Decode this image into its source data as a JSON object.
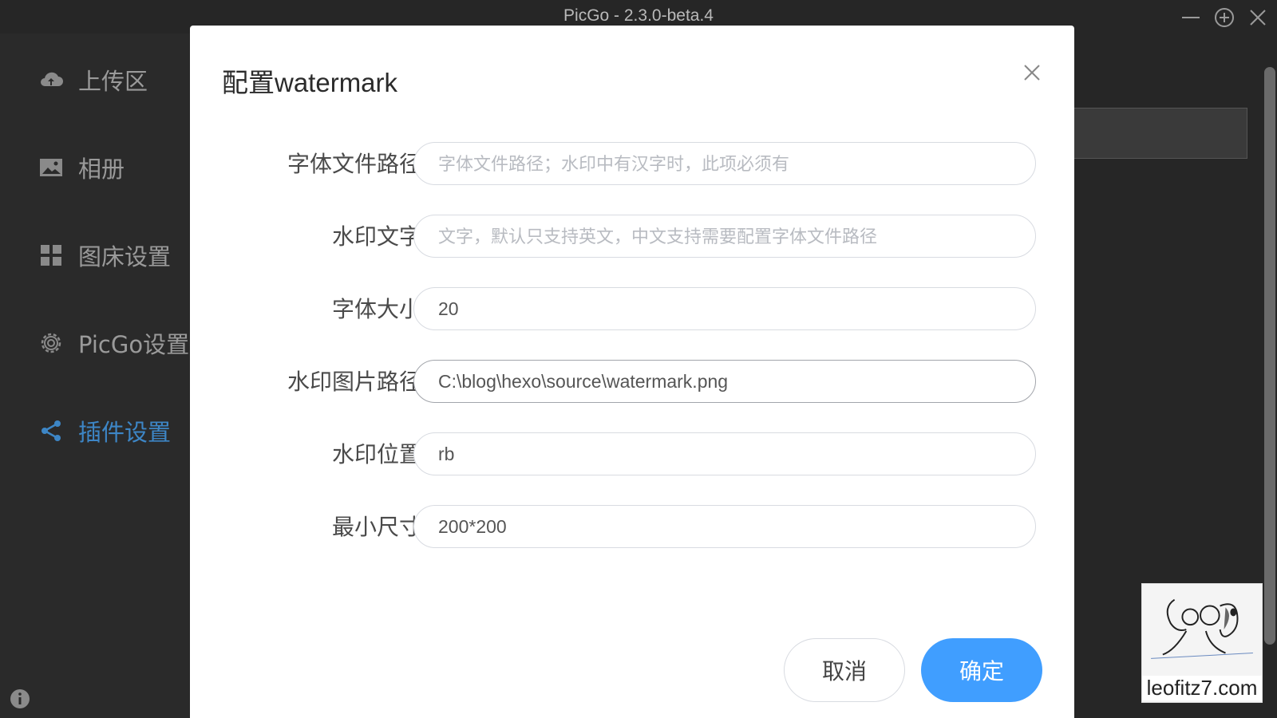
{
  "window": {
    "title": "PicGo - 2.3.0-beta.4"
  },
  "sidebar": {
    "items": [
      {
        "label": "上传区",
        "icon": "cloud-upload-icon"
      },
      {
        "label": "相册",
        "icon": "image-icon"
      },
      {
        "label": "图床设置",
        "icon": "grid-icon"
      },
      {
        "label": "PicGo设置",
        "icon": "gear-icon"
      },
      {
        "label": "插件设置",
        "icon": "share-icon",
        "active": true
      }
    ]
  },
  "dialog": {
    "title": "配置watermark",
    "fields": [
      {
        "label": "字体文件路径",
        "value": "",
        "placeholder": "字体文件路径；水印中有汉字时，此项必须有"
      },
      {
        "label": "水印文字",
        "value": "",
        "placeholder": "文字，默认只支持英文，中文支持需要配置字体文件路径"
      },
      {
        "label": "字体大小",
        "value": "20",
        "placeholder": ""
      },
      {
        "label": "水印图片路径",
        "value": "C:\\blog\\hexo\\source\\watermark.png",
        "placeholder": ""
      },
      {
        "label": "水印位置",
        "value": "rb",
        "placeholder": ""
      },
      {
        "label": "最小尺寸",
        "value": "200*200",
        "placeholder": ""
      }
    ],
    "cancel_label": "取消",
    "confirm_label": "确定"
  },
  "watermark": {
    "text": "leofitz7.com"
  },
  "colors": {
    "accent": "#409eff",
    "active_nav": "#3d86c6"
  }
}
